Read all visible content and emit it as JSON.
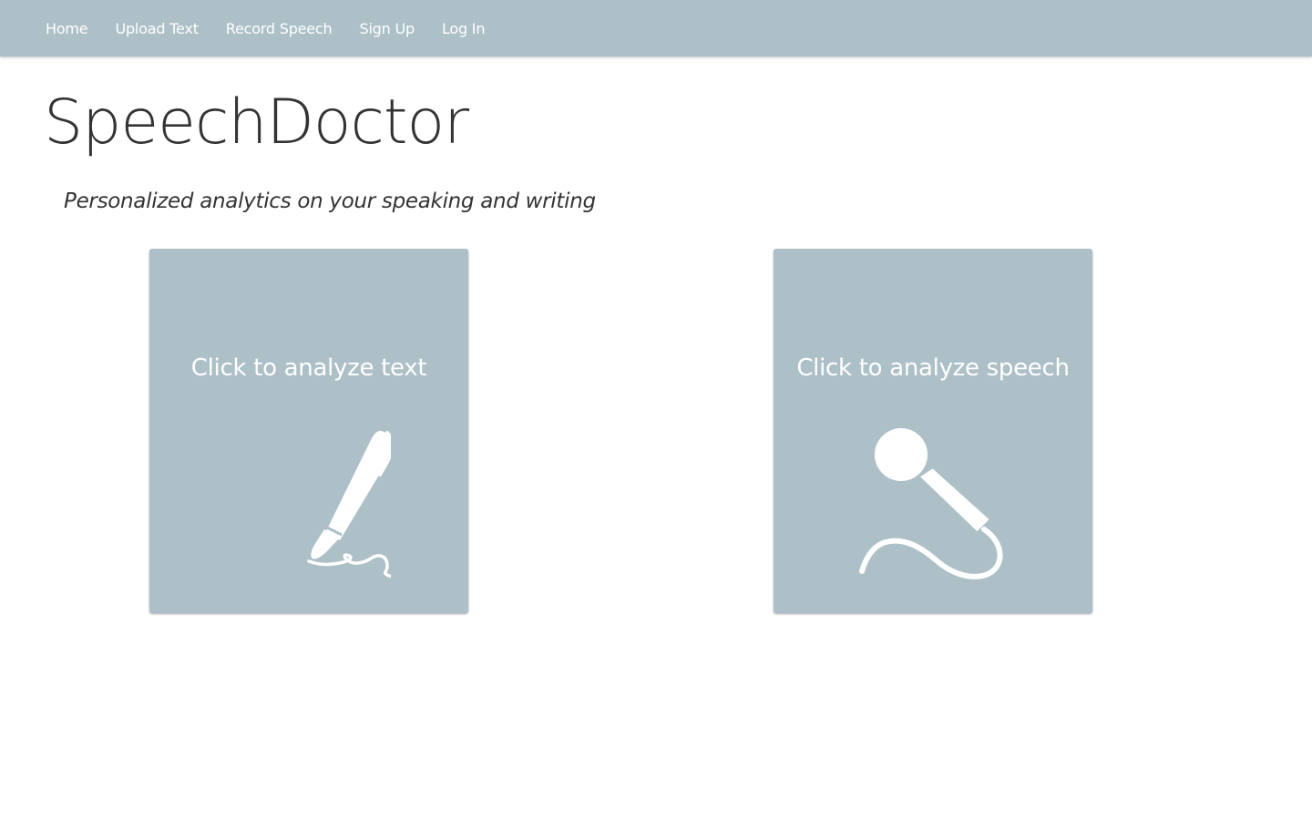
{
  "nav": {
    "items": [
      {
        "label": "Home"
      },
      {
        "label": "Upload Text"
      },
      {
        "label": "Record Speech"
      },
      {
        "label": "Sign Up"
      },
      {
        "label": "Log In"
      }
    ]
  },
  "header": {
    "brand": "SpeechDoctor",
    "tagline": "Personalized analytics on your speaking and writing"
  },
  "cards": {
    "text": {
      "label": "Click to analyze text",
      "icon": "pen-icon"
    },
    "speech": {
      "label": "Click to analyze speech",
      "icon": "microphone-icon"
    }
  },
  "colors": {
    "accent": "#adc0c8",
    "text": "#333333",
    "on_accent": "#ffffff"
  }
}
